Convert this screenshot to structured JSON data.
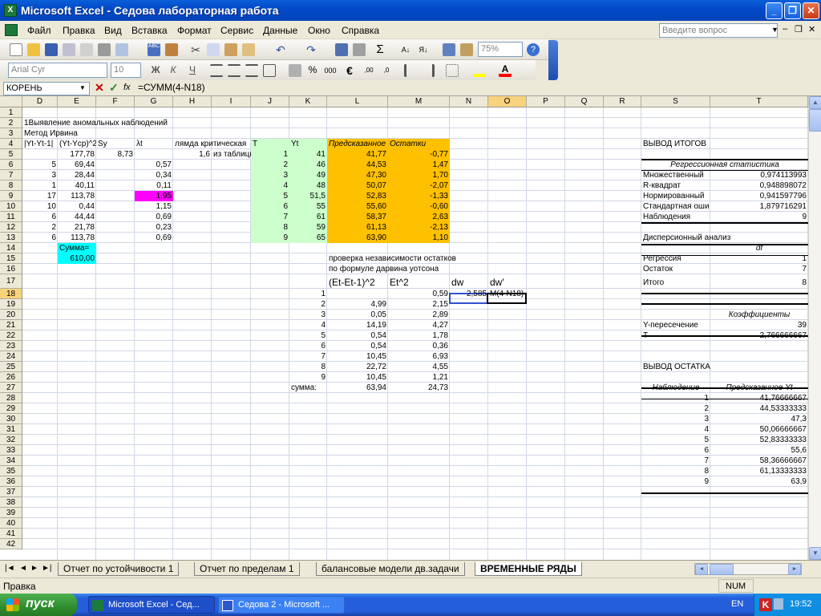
{
  "window": {
    "title": "Microsoft Excel - Седова лабораторная работа",
    "app_icon": "excel-icon"
  },
  "menu": {
    "items": [
      "Файл",
      "Правка",
      "Вид",
      "Вставка",
      "Формат",
      "Сервис",
      "Данные",
      "Окно",
      "Справка"
    ],
    "ask_placeholder": "Введите вопрос"
  },
  "toolbar": {
    "zoom": "75%",
    "font_name": "Arial Cyr",
    "font_size": "10",
    "bold": "Ж",
    "italic": "К",
    "underline": "Ч",
    "sigma": "Σ",
    "percent": "%",
    "thousands": "000",
    "euro": "€"
  },
  "formula_bar": {
    "name_box": "КОРЕНЬ",
    "formula": "=СУММ(4-N18)",
    "fx": "fx"
  },
  "columns": [
    "D",
    "E",
    "F",
    "G",
    "H",
    "I",
    "J",
    "K",
    "L",
    "M",
    "N",
    "O",
    "P",
    "Q",
    "R",
    "S",
    "T"
  ],
  "rows": [
    "1",
    "2",
    "3",
    "4",
    "5",
    "6",
    "7",
    "8",
    "9",
    "10",
    "11",
    "12",
    "13",
    "14",
    "15",
    "16",
    "17",
    "18",
    "19",
    "20",
    "21",
    "22",
    "23",
    "24",
    "25",
    "26",
    "27",
    "28",
    "29",
    "30",
    "31",
    "32",
    "33",
    "34",
    "35",
    "36",
    "37",
    "38",
    "39",
    "40",
    "41",
    "42"
  ],
  "cells": {
    "D2": "1Выявление аномальных наблюдений",
    "D3": "Метод Ирвина",
    "D4": "|Yt-Yt-1|",
    "E4": "(Yt-Ycp)^2",
    "F4": "Sy",
    "G4": "λt",
    "H4": "лямда критическая",
    "J4": "T",
    "K4": "Yt",
    "L4": "Предсказанное Y",
    "M4": "Остатки",
    "S4": "ВЫВОД ИТОГОВ",
    "E5": "177,78",
    "F5": "8,73",
    "H5": "1,6",
    "I5": "из таблицы",
    "J5": "1",
    "K5": "41",
    "L5": "41,77",
    "M5": "-0,77",
    "D6": "5",
    "E6": "69,44",
    "G6": "0,57",
    "J6": "2",
    "K6": "46",
    "L6": "44,53",
    "M6": "1,47",
    "D7": "3",
    "E7": "28,44",
    "G7": "0,34",
    "J7": "3",
    "K7": "49",
    "L7": "47,30",
    "M7": "1,70",
    "D8": "1",
    "E8": "40,11",
    "G8": "0,11",
    "J8": "4",
    "K8": "48",
    "L8": "50,07",
    "M8": "-2,07",
    "D9": "17",
    "E9": "113,78",
    "G9": "1,95",
    "J9": "5",
    "K9": "51,5",
    "L9": "52,83",
    "M9": "-1,33",
    "D10": "10",
    "E10": "0,44",
    "G10": "1,15",
    "J10": "6",
    "K10": "55",
    "L10": "55,60",
    "M10": "-0,60",
    "D11": "6",
    "E11": "44,44",
    "G11": "0,69",
    "J11": "7",
    "K11": "61",
    "L11": "58,37",
    "M11": "2,63",
    "D12": "2",
    "E12": "21,78",
    "G12": "0,23",
    "J12": "8",
    "K12": "59",
    "L12": "61,13",
    "M12": "-2,13",
    "D13": "6",
    "E13": "113,78",
    "G13": "0,69",
    "J13": "9",
    "K13": "65",
    "L13": "63,90",
    "M13": "1,10",
    "E14": "Сумма=",
    "E15": "610,00",
    "L15": "проверка независимости остатков",
    "L16": "по формуле дарвина уотсона",
    "L17": "(Et-Et-1)^2",
    "M17": "Et^2",
    "N17": "dw",
    "O17": "dw'",
    "K18": "1",
    "M18": "0,59",
    "N18": "2,585",
    "O18": "M(4-N18)",
    "K19": "2",
    "L19": "4,99",
    "M19": "2,15",
    "K20": "3",
    "L20": "0,05",
    "M20": "2,89",
    "K21": "4",
    "L21": "14,19",
    "M21": "4,27",
    "K22": "5",
    "L22": "0,54",
    "M22": "1,78",
    "K23": "6",
    "L23": "0,54",
    "M23": "0,36",
    "K24": "7",
    "L24": "10,45",
    "M24": "6,93",
    "K25": "8",
    "L25": "22,72",
    "M25": "4,55",
    "K26": "9",
    "L26": "10,45",
    "M26": "1,21",
    "K27": "сумма:",
    "L27": "63,94",
    "M27": "24,73",
    "S6": "Регрессионная статистика",
    "S7": "Множественный",
    "T7": "0,974113993",
    "S8": "R-квадрат",
    "T8": "0,948898072",
    "S9": "Нормированный",
    "T9": "0,941597796",
    "S10": "Стандартная оши",
    "T10": "1,879716291",
    "S11": "Наблюдения",
    "T11": "9",
    "S13": "Дисперсионный анализ",
    "T14": "df",
    "S15": "Регрессия",
    "T15": "1",
    "S16": "Остаток",
    "T16": "7",
    "S17": "Итого",
    "T17": "8",
    "T20": "Коэффициенты",
    "S21": "Y-пересечение",
    "T21": "39",
    "S22": "T",
    "T22": "2,766666667",
    "S25": "ВЫВОД ОСТАТКА",
    "S27": "Наблюдение",
    "T27": "Предсказанное Yt",
    "T28": "41,76666667",
    "S28": "1",
    "T29": "44,53333333",
    "S29": "2",
    "T30": "47,3",
    "S30": "3",
    "T31": "50,06666667",
    "S31": "4",
    "T32": "52,83333333",
    "S32": "5",
    "T33": "55,6",
    "S33": "6",
    "T34": "58,36666667",
    "S34": "7",
    "T35": "61,13333333",
    "S35": "8",
    "T36": "63,9",
    "S36": "9"
  },
  "sheet_tabs": [
    "Отчет по устойчивости 1",
    "Отчет по пределам 1",
    "балансовые модели дв.задачи",
    "ВРЕМЕННЫЕ РЯДЫ"
  ],
  "active_tab": "ВРЕМЕННЫЕ РЯДЫ",
  "status": {
    "mode": "Правка",
    "num": "NUM"
  },
  "taskbar": {
    "start": "пуск",
    "tasks": [
      "Microsoft Excel - Сед...",
      "Седова 2 - Microsoft ..."
    ],
    "lang": "EN",
    "clock": "19:52"
  },
  "colors": {
    "green": "#ccffcc",
    "orange": "#ffc000",
    "magenta": "#ff00ff",
    "cyan": "#00ffff"
  }
}
